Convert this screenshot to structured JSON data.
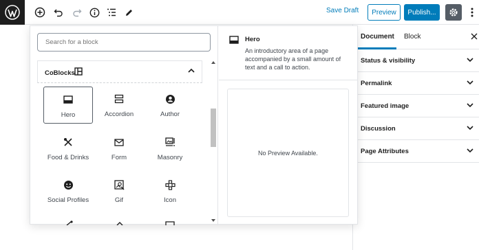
{
  "toolbar": {
    "save_draft": "Save Draft",
    "preview": "Preview",
    "publish": "Publish...",
    "icons": [
      "wordpress-logo-icon",
      "add-block-icon",
      "undo-icon",
      "redo-icon",
      "info-icon",
      "list-view-icon",
      "edit-tools-icon",
      "settings-gear-icon",
      "more-options-icon"
    ],
    "accent": "#007cba"
  },
  "inserter": {
    "search_placeholder": "Search for a block",
    "panel_title": "CoBlocks",
    "blocks": [
      {
        "label": "Hero",
        "icon": "hero-icon",
        "selected": true
      },
      {
        "label": "Accordion",
        "icon": "accordion-icon"
      },
      {
        "label": "Author",
        "icon": "author-icon"
      },
      {
        "label": "Food & Drinks",
        "icon": "food-drinks-icon"
      },
      {
        "label": "Form",
        "icon": "form-icon"
      },
      {
        "label": "Masonry",
        "icon": "masonry-icon"
      },
      {
        "label": "Social Profiles",
        "icon": "social-profiles-icon"
      },
      {
        "label": "Gif",
        "icon": "gif-icon"
      },
      {
        "label": "Icon",
        "icon": "icon-block-icon"
      }
    ],
    "preview": {
      "title": "Hero",
      "description": "An introductory area of a page accompanied by a small amount of text and a call to action.",
      "no_preview": "No Preview Available."
    }
  },
  "sidebar": {
    "tabs": [
      "Document",
      "Block"
    ],
    "sections": [
      "Status & visibility",
      "Permalink",
      "Featured image",
      "Discussion",
      "Page Attributes"
    ]
  }
}
